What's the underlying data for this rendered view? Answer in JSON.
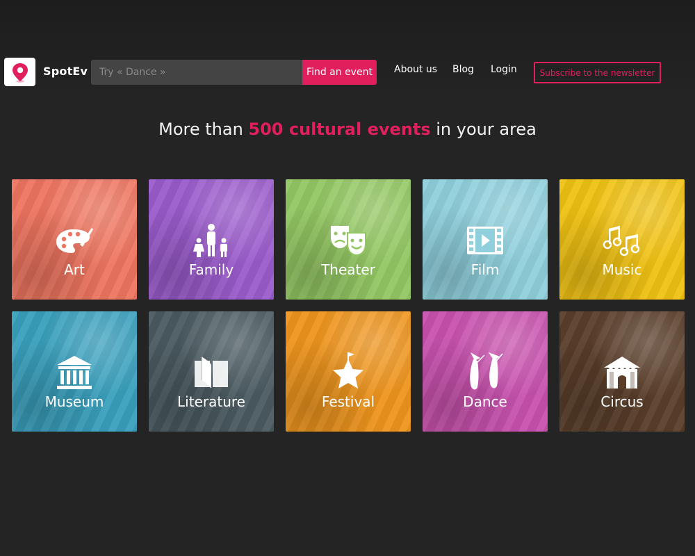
{
  "header": {
    "brand": "SpotEv",
    "search_placeholder": "Try « Dance »",
    "find_button": "Find an event",
    "nav": [
      "About us",
      "Blog",
      "Login"
    ],
    "subscribe_button": "Subscribe to the newsletter"
  },
  "headline": {
    "prefix": "More than ",
    "accent": "500 cultural events",
    "suffix": " in your area"
  },
  "colors": {
    "accent": "#e01f5c",
    "background": "#242424"
  },
  "categories": [
    {
      "label": "Art",
      "icon": "palette-icon",
      "color": "#ee7560"
    },
    {
      "label": "Family",
      "icon": "family-icon",
      "color": "#9b5ccc"
    },
    {
      "label": "Theater",
      "icon": "theater-masks-icon",
      "color": "#93c763"
    },
    {
      "label": "Film",
      "icon": "film-icon",
      "color": "#8fd0dc"
    },
    {
      "label": "Music",
      "icon": "music-notes-icon",
      "color": "#f0c213"
    },
    {
      "label": "Museum",
      "icon": "museum-icon",
      "color": "#3aa0bd"
    },
    {
      "label": "Literature",
      "icon": "book-icon",
      "color": "#4b5b61"
    },
    {
      "label": "Festival",
      "icon": "festival-star-icon",
      "color": "#ee951e"
    },
    {
      "label": "Dance",
      "icon": "ballet-shoes-icon",
      "color": "#c852ae"
    },
    {
      "label": "Circus",
      "icon": "circus-tent-icon",
      "color": "#5a3e2a"
    }
  ]
}
